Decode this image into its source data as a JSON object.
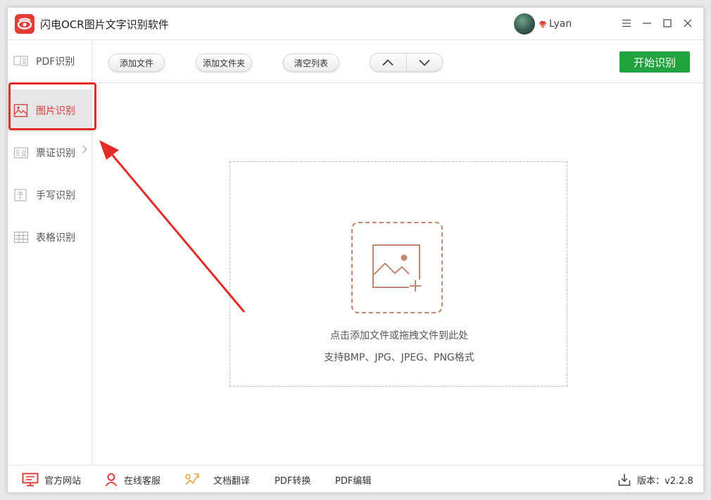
{
  "app": {
    "title": "闪电OCR图片文字识别软件",
    "user": "Lyan"
  },
  "sidebar": {
    "items": [
      {
        "label": "PDF识别"
      },
      {
        "label": "图片识别"
      },
      {
        "label": "票证识别"
      },
      {
        "label": "手写识别"
      },
      {
        "label": "表格识别"
      }
    ],
    "active_index": 1
  },
  "toolbar": {
    "add_file": "添加文件",
    "add_folder": "添加文件夹",
    "clear_list": "清空列表",
    "move_up_icon": "chevron-up-icon",
    "move_down_icon": "chevron-down-icon",
    "start": "开始识别"
  },
  "dropzone": {
    "icon": "image-add-icon",
    "hint": "点击添加文件或拖拽文件到此处",
    "formats": "支持BMP、JPG、JPEG、PNG格式"
  },
  "statusbar": {
    "website": "官方网站",
    "support": "在线客服",
    "translate": "文档翻译",
    "pdf_convert": "PDF转换",
    "pdf_edit": "PDF编辑",
    "version": "版本：v2.2.8"
  },
  "colors": {
    "brand_red": "#e43b34",
    "active_text": "#d83a36",
    "start_green": "#1fa33e",
    "drop_icon": "#c48770",
    "annotation_red": "#e42b27"
  }
}
